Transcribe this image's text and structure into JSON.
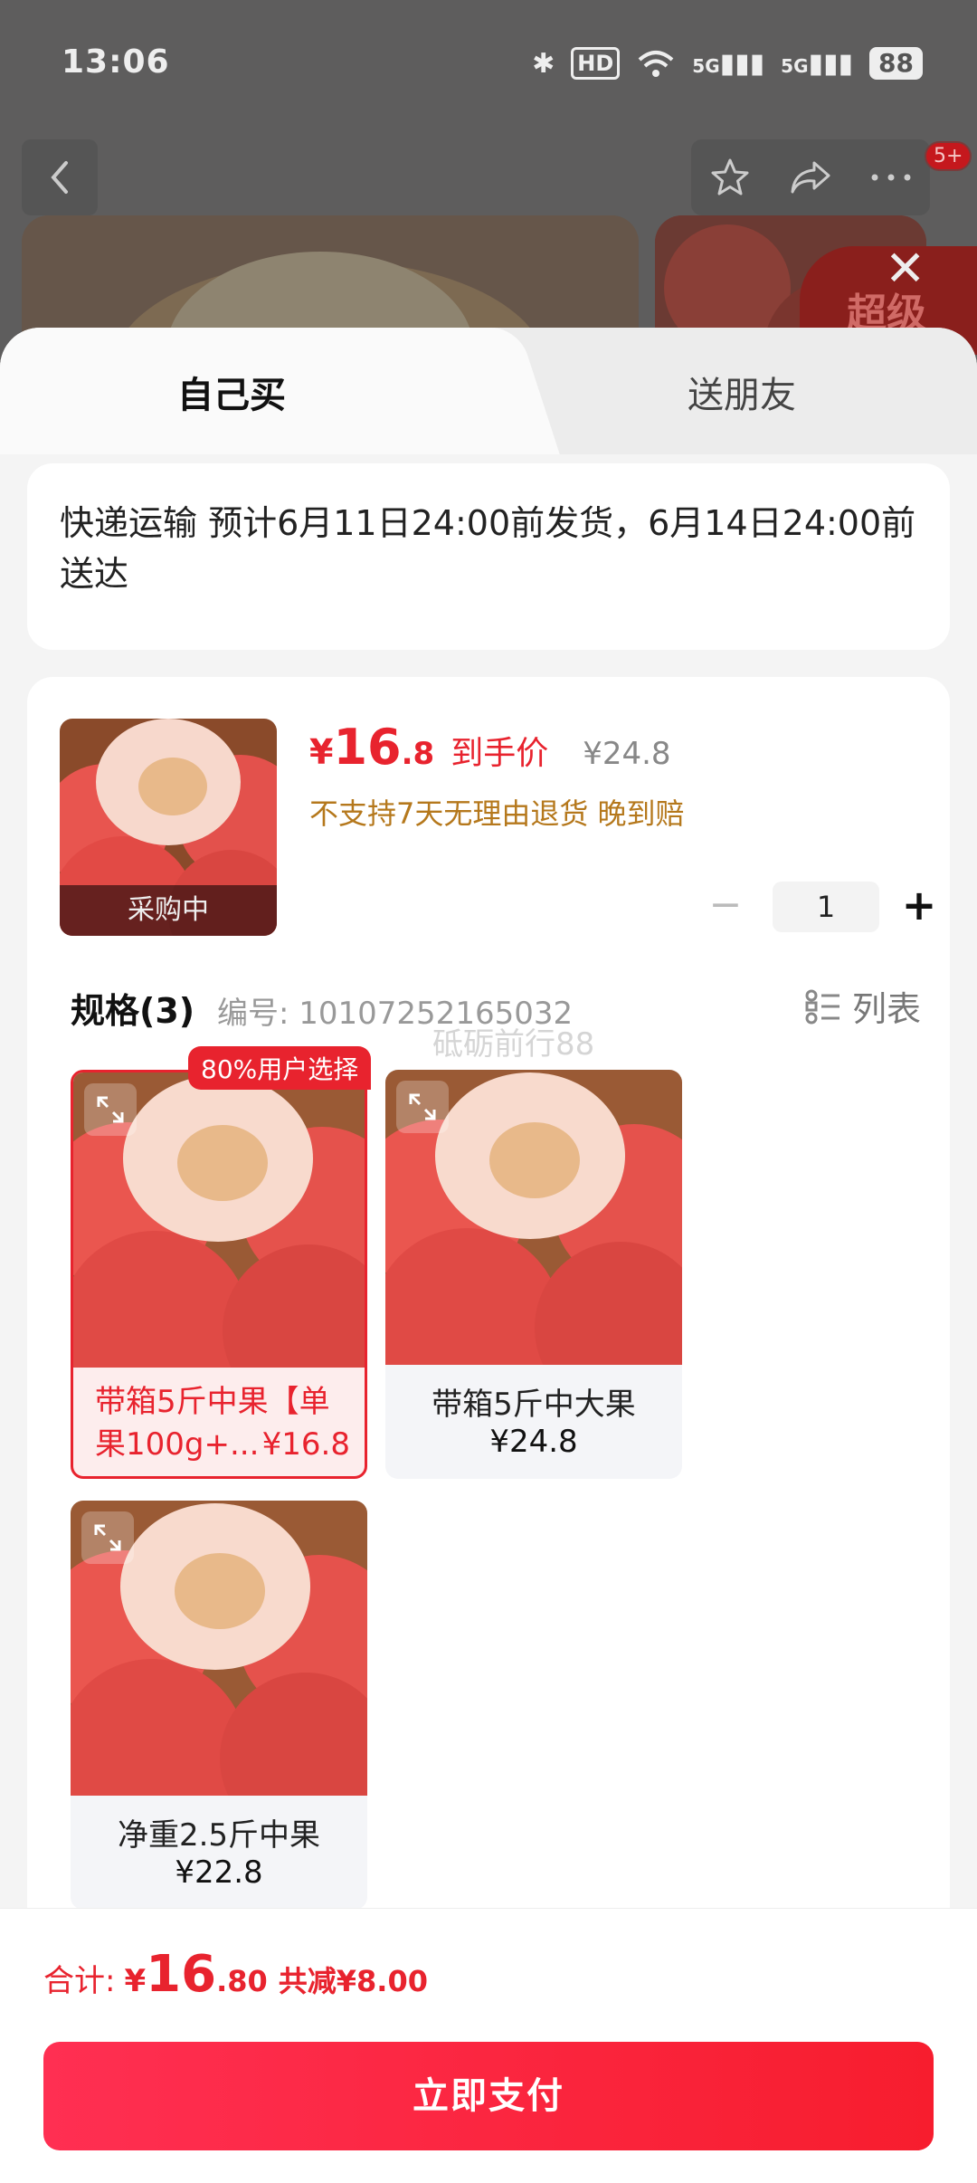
{
  "status_bar": {
    "time": "13:06",
    "hd": "HD",
    "network_1": "5G",
    "network_2": "5G",
    "battery": "88"
  },
  "background_page": {
    "notification_badge": "5+",
    "banner_text": "超级"
  },
  "sheet": {
    "tabs": [
      {
        "label": "自己买",
        "active": true
      },
      {
        "label": "送朋友",
        "active": false
      }
    ],
    "delivery": {
      "text": "快递运输 预计6月11日24:00前发货，6月14日24:00前送达"
    },
    "product": {
      "thumbnail_status": "采购中",
      "price_symbol": "¥",
      "price_int": "16",
      "price_dec": ".8",
      "price_tag": "到手价",
      "original_price": "¥24.8",
      "policy_text": "不支持7天无理由退货  晚到赔",
      "quantity": "1",
      "minus_label": "−",
      "plus_label": "+"
    },
    "spec": {
      "title": "规格(3)",
      "code": "编号: 10107252165032",
      "watermark": "砥砺前行88",
      "list_label": "列表",
      "variants": [
        {
          "label_line1": "带箱5斤中果【单",
          "label_line2": "果100g+...",
          "price": "¥16.8",
          "selected": true,
          "badge": "80%用户选择"
        },
        {
          "label": "带箱5斤中大果",
          "price": "¥24.8",
          "selected": false
        },
        {
          "label": "净重2.5斤中果",
          "price": "¥22.8",
          "selected": false
        }
      ]
    }
  },
  "footer": {
    "total_label": "合计:",
    "total_symbol": "¥",
    "total_int": "16",
    "total_dec": ".80",
    "discount_text": "共减¥8.00",
    "pay_button": "立即支付"
  },
  "colors": {
    "accent": "#e8232e",
    "policy": "#b5781c",
    "pay_gradient_start": "#ff2f52",
    "pay_gradient_end": "#f71d2e"
  }
}
